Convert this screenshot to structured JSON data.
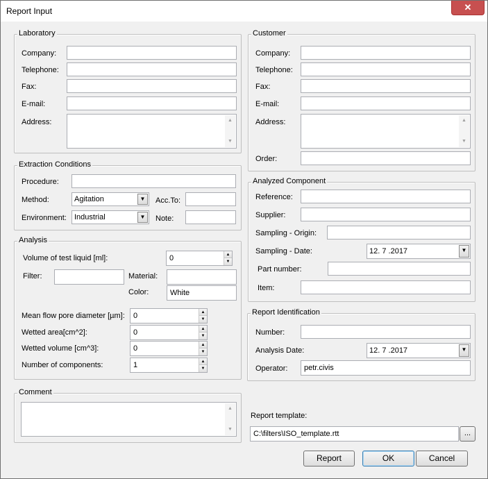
{
  "window": {
    "title": "Report Input",
    "close_glyph": "✕"
  },
  "laboratory": {
    "legend": "Laboratory",
    "company_label": "Company:",
    "company_value": "",
    "telephone_label": "Telephone:",
    "telephone_value": "",
    "fax_label": "Fax:",
    "fax_value": "",
    "email_label": "E-mail:",
    "email_value": "",
    "address_label": "Address:",
    "address_value": ""
  },
  "customer": {
    "legend": "Customer",
    "company_label": "Company:",
    "company_value": "",
    "telephone_label": "Telephone:",
    "telephone_value": "",
    "fax_label": "Fax:",
    "fax_value": "",
    "email_label": "E-mail:",
    "email_value": "",
    "address_label": "Address:",
    "address_value": "",
    "order_label": "Order:",
    "order_value": ""
  },
  "extraction": {
    "legend": "Extraction Conditions",
    "procedure_label": "Procedure:",
    "procedure_value": "",
    "method_label": "Method:",
    "method_value": "Agitation",
    "acc_to_label": "Acc.To:",
    "acc_to_value": "",
    "environment_label": "Environment:",
    "environment_value": "Industrial",
    "note_label": "Note:",
    "note_value": ""
  },
  "analyzed_component": {
    "legend": "Analyzed Component",
    "reference_label": "Reference:",
    "reference_value": "",
    "supplier_label": "Supplier:",
    "supplier_value": "",
    "sampling_origin_label": "Sampling - Origin:",
    "sampling_origin_value": "",
    "sampling_date_label": "Sampling - Date:",
    "sampling_date_value": "12. 7 .2017",
    "part_number_label": "Part number:",
    "part_number_value": "",
    "item_label": "Item:",
    "item_value": ""
  },
  "analysis": {
    "legend": "Analysis",
    "volume_label": "Volume of test liquid [ml]:",
    "volume_value": "0",
    "filter_label": "Filter:",
    "filter_value": "",
    "material_label": "Material:",
    "material_value": "",
    "color_label": "Color:",
    "color_value": "White",
    "mean_flow_label": "Mean flow pore diameter [µm]:",
    "mean_flow_value": "0",
    "wetted_area_label": "Wetted area[cm^2]:",
    "wetted_area_value": "0",
    "wetted_volume_label": "Wetted volume [cm^3]:",
    "wetted_volume_value": "0",
    "components_label": "Number of components:",
    "components_value": "1"
  },
  "report_identification": {
    "legend": "Report Identification",
    "number_label": "Number:",
    "number_value": "",
    "analysis_date_label": "Analysis Date:",
    "analysis_date_value": "12. 7 .2017",
    "operator_label": "Operator:",
    "operator_value": "petr.civis"
  },
  "comment": {
    "legend": "Comment",
    "value": ""
  },
  "template": {
    "label": "Report template:",
    "path": "C:\\filters\\ISO_template.rtt",
    "browse_label": "..."
  },
  "buttons": {
    "report": "Report",
    "ok": "OK",
    "cancel": "Cancel"
  },
  "glyphs": {
    "down": "▼",
    "up": "▲"
  },
  "colors": {
    "close_button": "#c75050",
    "default_button_border": "#3c7fb1"
  }
}
